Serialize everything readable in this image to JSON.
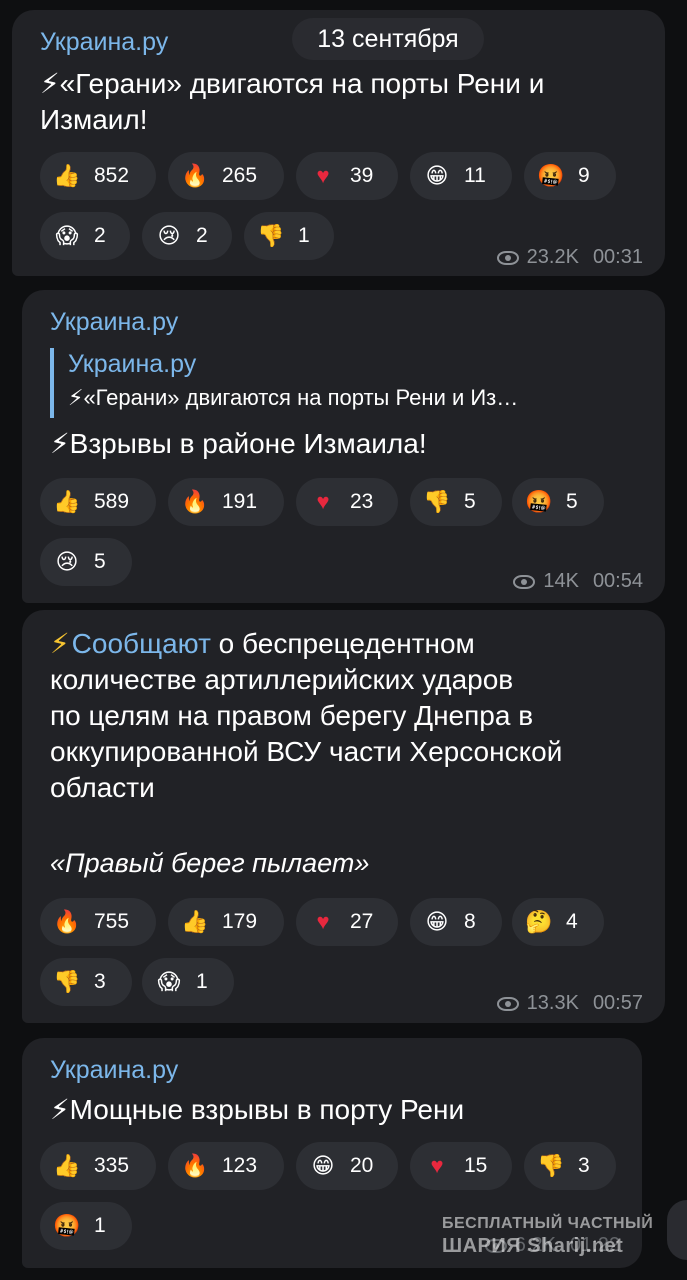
{
  "date_label": "13 сентября",
  "colors": {
    "background": "#0e0f11",
    "bubble": "#212226",
    "reaction_pill": "#2d2f34",
    "sender": "#7cb7ea",
    "meta": "#8e9297"
  },
  "messages": [
    {
      "sender": "Украина.ру",
      "text_lines": [
        "⚡«Герани» двигаются на порты Рени и",
        "Измаил!"
      ],
      "reactions": [
        {
          "icon": "thumbs-up",
          "count": "852"
        },
        {
          "icon": "fire",
          "count": "265"
        },
        {
          "icon": "heart",
          "count": "39"
        },
        {
          "icon": "grinning-face",
          "count": "11"
        },
        {
          "icon": "cursing-face",
          "count": "9"
        },
        {
          "icon": "screaming-face",
          "count": "2"
        },
        {
          "icon": "crying-face",
          "count": "2"
        },
        {
          "icon": "thumbs-down",
          "count": "1"
        }
      ],
      "views": "23.2K",
      "time": "00:31"
    },
    {
      "sender": "Украина.ру",
      "quote": {
        "sender": "Украина.ру",
        "text": "⚡«Герани» двигаются на порты Рени и Из…"
      },
      "text_lines": [
        "⚡Взрывы в районе Измаила!"
      ],
      "reactions": [
        {
          "icon": "thumbs-up",
          "count": "589"
        },
        {
          "icon": "fire",
          "count": "191"
        },
        {
          "icon": "heart",
          "count": "23"
        },
        {
          "icon": "thumbs-down",
          "count": "5"
        },
        {
          "icon": "cursing-face",
          "count": "5"
        },
        {
          "icon": "crying-face",
          "count": "5"
        }
      ],
      "views": "14K",
      "time": "00:54"
    },
    {
      "link_word": "Сообщают",
      "text_first_line_rest": " о беспрецедентном",
      "text_lines": [
        "количестве артиллерийских ударов",
        "по целям на правом берегу Днепра в",
        "оккупированной ВСУ части Херсонской",
        "области"
      ],
      "italic_line": "«Правый берег пылает»",
      "reactions": [
        {
          "icon": "fire",
          "count": "755"
        },
        {
          "icon": "thumbs-up",
          "count": "179"
        },
        {
          "icon": "heart",
          "count": "27"
        },
        {
          "icon": "grinning-face",
          "count": "8"
        },
        {
          "icon": "thinking-face",
          "count": "4"
        },
        {
          "icon": "thumbs-down",
          "count": "3"
        },
        {
          "icon": "screaming-face",
          "count": "1"
        }
      ],
      "views": "13.3K",
      "time": "00:57"
    },
    {
      "sender": "Украина.ру",
      "text_lines": [
        "⚡Мощные взрывы в порту Рени"
      ],
      "reactions": [
        {
          "icon": "thumbs-up",
          "count": "335"
        },
        {
          "icon": "fire",
          "count": "123"
        },
        {
          "icon": "grinning-face",
          "count": "20"
        },
        {
          "icon": "heart",
          "count": "15"
        },
        {
          "icon": "thumbs-down",
          "count": "3"
        },
        {
          "icon": "cursing-face",
          "count": "1"
        }
      ],
      "views": "6.2K",
      "time": "01:22"
    }
  ],
  "watermark": {
    "line1": "БЕСПЛАТНЫЙ ЧАСТНЫЙ",
    "line2": "ШАРИЯ Sharij.net"
  }
}
